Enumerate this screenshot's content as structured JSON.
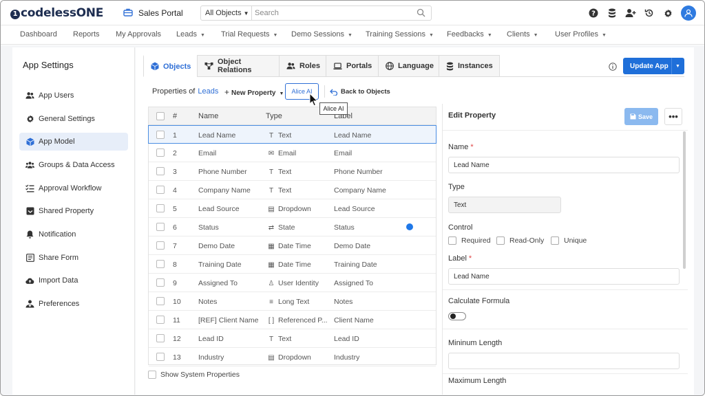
{
  "brand": {
    "logo_mark": "1",
    "logo_text": "codeless",
    "logo_one": "ONE"
  },
  "app": {
    "name": "Sales Portal"
  },
  "search": {
    "scope": "All Objects",
    "placeholder": "Search"
  },
  "nav": [
    {
      "label": "Dashboard",
      "dropdown": false
    },
    {
      "label": "Reports",
      "dropdown": false
    },
    {
      "label": "My Approvals",
      "dropdown": false
    },
    {
      "label": "Leads",
      "dropdown": true
    },
    {
      "label": "Trial Requests",
      "dropdown": true
    },
    {
      "label": "Demo Sessions",
      "dropdown": true
    },
    {
      "label": "Training Sessions",
      "dropdown": true
    },
    {
      "label": "Feedbacks",
      "dropdown": true
    },
    {
      "label": "Clients",
      "dropdown": true
    },
    {
      "label": "User Profiles",
      "dropdown": true
    }
  ],
  "sidebar": {
    "title": "App Settings",
    "items": [
      {
        "label": "App Users",
        "icon": "users-icon"
      },
      {
        "label": "General Settings",
        "icon": "gear-icon"
      },
      {
        "label": "App Model",
        "icon": "cube-icon",
        "active": true
      },
      {
        "label": "Groups & Data Access",
        "icon": "group-icon"
      },
      {
        "label": "Approval Workflow",
        "icon": "checklist-icon"
      },
      {
        "label": "Shared Property",
        "icon": "shared-icon"
      },
      {
        "label": "Notification",
        "icon": "bell-icon"
      },
      {
        "label": "Share Form",
        "icon": "form-icon"
      },
      {
        "label": "Import Data",
        "icon": "cloud-upload-icon"
      },
      {
        "label": "Preferences",
        "icon": "user-heart-icon"
      }
    ]
  },
  "tabs": [
    {
      "label": "Objects",
      "active": true
    },
    {
      "label": "Object Relations"
    },
    {
      "label": "Roles"
    },
    {
      "label": "Portals"
    },
    {
      "label": "Language"
    },
    {
      "label": "Instances"
    }
  ],
  "toolbar": {
    "update_label": "Update App",
    "props_of_label": "Properties of",
    "object_name": "Leads",
    "new_property_label": "New Property",
    "alice_label": "Alice AI",
    "back_label": "Back to Objects",
    "tooltip": "Alice AI"
  },
  "table": {
    "headers": {
      "num": "#",
      "name": "Name",
      "type": "Type",
      "label": "Label"
    },
    "rows": [
      {
        "num": "1",
        "name": "Lead Name",
        "type": "Text",
        "type_icon": "T",
        "label": "Lead Name",
        "selected": true
      },
      {
        "num": "2",
        "name": "Email",
        "type": "Email",
        "type_icon": "✉",
        "label": "Email"
      },
      {
        "num": "3",
        "name": "Phone Number",
        "type": "Text",
        "type_icon": "T",
        "label": "Phone Number"
      },
      {
        "num": "4",
        "name": "Company Name",
        "type": "Text",
        "type_icon": "T",
        "label": "Company Name"
      },
      {
        "num": "5",
        "name": "Lead Source",
        "type": "Dropdown",
        "type_icon": "▤",
        "label": "Lead Source"
      },
      {
        "num": "6",
        "name": "Status",
        "type": "State",
        "type_icon": "⇄",
        "label": "Status",
        "dot": true
      },
      {
        "num": "7",
        "name": "Demo Date",
        "type": "Date Time",
        "type_icon": "▦",
        "label": "Demo Date"
      },
      {
        "num": "8",
        "name": "Training Date",
        "type": "Date Time",
        "type_icon": "▦",
        "label": "Training Date"
      },
      {
        "num": "9",
        "name": "Assigned To",
        "type": "User Identity",
        "type_icon": "♙",
        "label": "Assigned To"
      },
      {
        "num": "10",
        "name": "Notes",
        "type": "Long Text",
        "type_icon": "≡",
        "label": "Notes"
      },
      {
        "num": "11",
        "name": "[REF] Client Name",
        "type": "Referenced P...",
        "type_icon": "[ ]",
        "label": "Client Name"
      },
      {
        "num": "12",
        "name": "Lead ID",
        "type": "Text",
        "type_icon": "T",
        "label": "Lead ID"
      },
      {
        "num": "13",
        "name": "Industry",
        "type": "Dropdown",
        "type_icon": "▤",
        "label": "Industry"
      }
    ],
    "show_system_label": "Show System Properties"
  },
  "edit": {
    "title": "Edit Property",
    "save_label": "Save",
    "more_label": "•••",
    "name_label": "Name",
    "name_value": "Lead Name",
    "type_label": "Type",
    "type_value": "Text",
    "control_label": "Control",
    "required_label": "Required",
    "readonly_label": "Read-Only",
    "unique_label": "Unique",
    "label_label": "Label",
    "label_value": "Lead Name",
    "formula_label": "Calculate Formula",
    "min_label": "Mininum Length",
    "max_label": "Maximum Length",
    "req_mark": "*"
  },
  "colors": {
    "accent": "#1f6fd9",
    "dot": "#1f78e8",
    "required": "#e04343"
  }
}
